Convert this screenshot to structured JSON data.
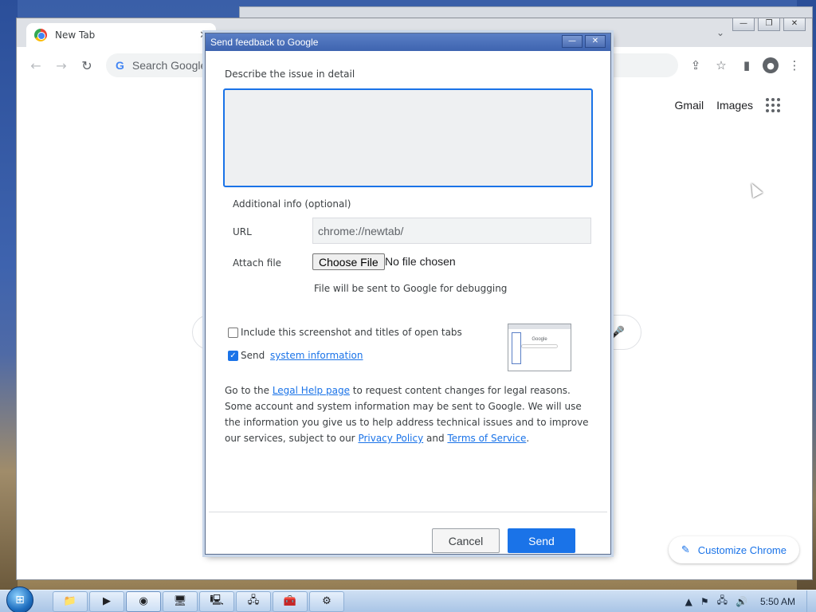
{
  "browser": {
    "tab_title": "New Tab",
    "tab_close": "✕",
    "omnibox_placeholder": "Search Google",
    "ntp_links": [
      "Gmail",
      "Images"
    ],
    "customize_label": "Customize Chrome"
  },
  "dialog": {
    "title": "Send feedback to Google",
    "describe_label": "Describe the issue in detail",
    "issue_text": "",
    "additional_label": "Additional info (optional)",
    "url_label": "URL",
    "url_value": "chrome://newtab/",
    "attach_label": "Attach file",
    "choose_file_label": "Choose File",
    "no_file_label": "No file chosen",
    "file_note": "File will be sent to Google for debugging",
    "screenshot_checkbox_label": "Include this screenshot and titles of open tabs",
    "screenshot_checked": false,
    "sysinfo_prefix": "Send ",
    "sysinfo_link": "system information",
    "sysinfo_checked": true,
    "legal": {
      "p1": "Go to the ",
      "link1": "Legal Help page",
      "p2": " to request content changes for legal reasons. Some account and system information may be sent to Google. We will use the information you give us to help address technical issues and to improve our services, subject to our ",
      "link2": "Privacy Policy",
      "p3": " and ",
      "link3": "Terms of Service",
      "p4": "."
    },
    "cancel_label": "Cancel",
    "send_label": "Send"
  },
  "thumbnail": {
    "brand": "Google"
  },
  "taskbar": {
    "clock": "5:50 AM"
  },
  "colors": {
    "accent": "#1a73e8",
    "dialog_titlebar": "#4a70b8"
  }
}
